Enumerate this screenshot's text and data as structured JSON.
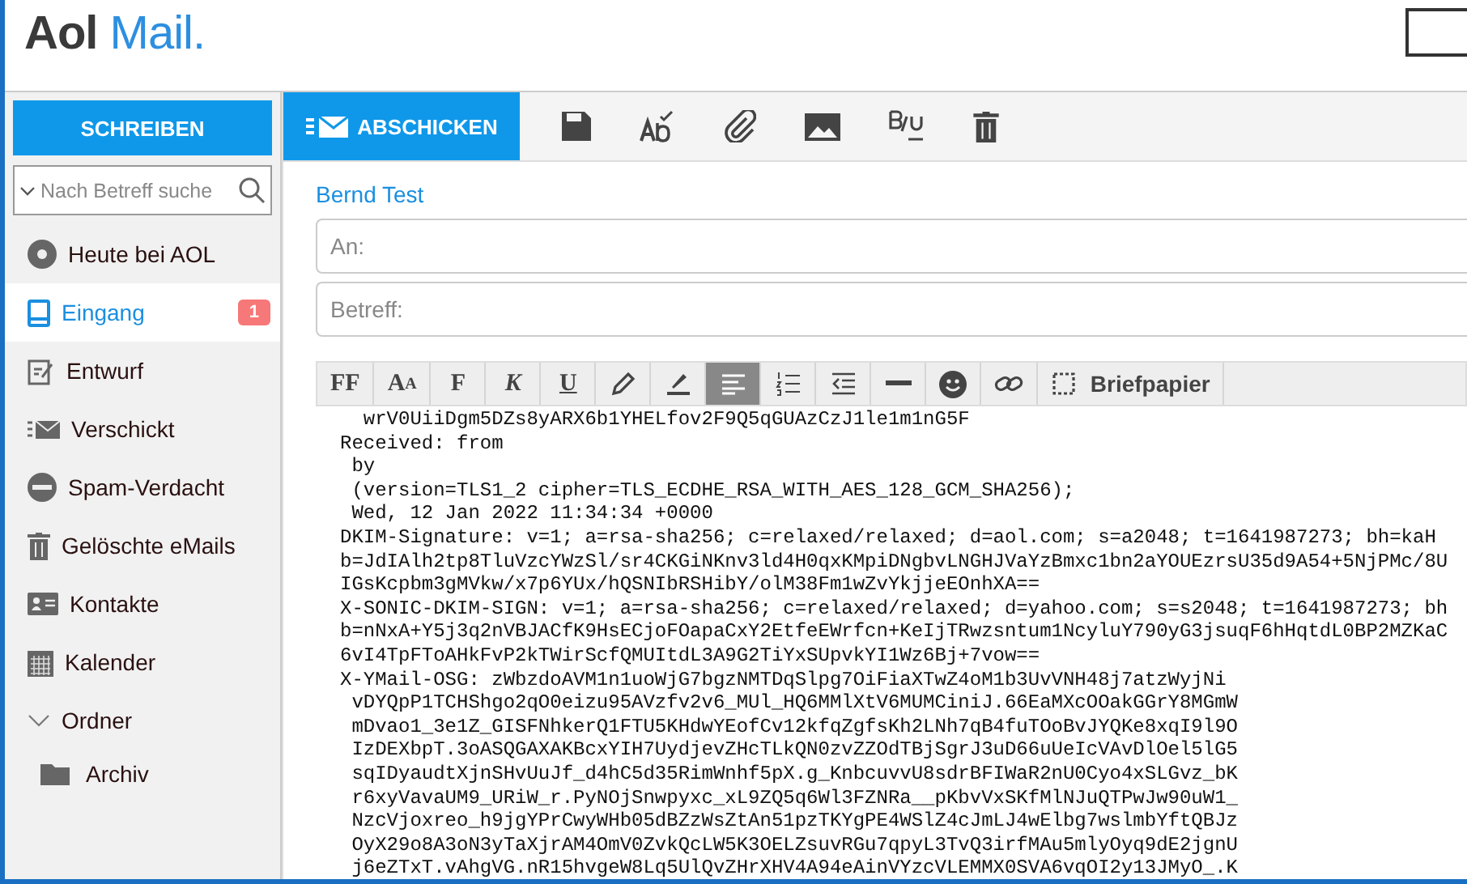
{
  "header": {
    "logo_bold": "Aol",
    "logo_light": "Mail."
  },
  "compose_button": "SCHREIBEN",
  "search": {
    "placeholder": "Nach Betreff suche"
  },
  "folders": [
    {
      "kind": "aol",
      "label": "Heute bei AOL",
      "selected": false
    },
    {
      "kind": "inbox",
      "label": "Eingang",
      "selected": true,
      "badge": "1"
    },
    {
      "kind": "draft",
      "label": "Entwurf",
      "selected": false
    },
    {
      "kind": "sent",
      "label": "Verschickt",
      "selected": false
    },
    {
      "kind": "spam",
      "label": "Spam-Verdacht",
      "selected": false
    },
    {
      "kind": "trash",
      "label": "Gelöschte eMails",
      "selected": false
    },
    {
      "kind": "contacts",
      "label": "Kontakte",
      "selected": false
    },
    {
      "kind": "calendar",
      "label": "Kalender",
      "selected": false
    },
    {
      "kind": "group",
      "label": "Ordner",
      "expanded": true,
      "children": [
        {
          "kind": "folder",
          "label": "Archiv",
          "selected": false
        }
      ]
    }
  ],
  "send_button": "ABSCHICKEN",
  "from": "Bernd Test",
  "to": {
    "placeholder": "An:"
  },
  "subject": {
    "placeholder": "Betreff:"
  },
  "format_tools": [
    {
      "kind": "font",
      "label": "FF",
      "selected": false
    },
    {
      "kind": "size",
      "label": "AA",
      "selected": false
    },
    {
      "kind": "bold",
      "label": "F",
      "selected": false
    },
    {
      "kind": "italic",
      "label": "K",
      "selected": false
    },
    {
      "kind": "underline",
      "label": "U",
      "selected": false
    },
    {
      "kind": "pen",
      "selected": false
    },
    {
      "kind": "highlight",
      "selected": false
    },
    {
      "kind": "align",
      "selected": true
    },
    {
      "kind": "list",
      "selected": false
    },
    {
      "kind": "outdent",
      "selected": false
    },
    {
      "kind": "rule",
      "selected": false
    },
    {
      "kind": "emoji",
      "selected": false
    },
    {
      "kind": "link",
      "selected": false
    },
    {
      "kind": "stationery",
      "label": "Briefpapier",
      "selected": false
    }
  ],
  "body_lines": [
    "  wrV0UiiDgm5DZs8yARX6b1YHELfov2F9Q5qGUAzCzJ1le1m1nG5F",
    "Received: from",
    " by",
    " (version=TLS1_2 cipher=TLS_ECDHE_RSA_WITH_AES_128_GCM_SHA256);",
    " Wed, 12 Jan 2022 11:34:34 +0000",
    "DKIM-Signature: v=1; a=rsa-sha256; c=relaxed/relaxed; d=aol.com; s=a2048; t=1641987273; bh=kaH",
    "b=JdIAlh2tp8TluVzcYWzSl/sr4CKGiNKnv3ld4H0qxKMpiDNgbvLNGHJVaYzBmxc1bn2aYOUEzrsU35d9A54+5NjPMc/8U",
    "IGsKcpbm3gMVkw/x7p6YUx/hQSNIbRSHibY/olM38Fm1wZvYkjjeEOnhXA==",
    "X-SONIC-DKIM-SIGN: v=1; a=rsa-sha256; c=relaxed/relaxed; d=yahoo.com; s=s2048; t=1641987273; bh",
    "b=nNxA+Y5j3q2nVBJACfK9HsECjoFOapaCxY2EtfeEWrfcn+KeIjTRwzsntum1NcyluY790yG3jsuqF6hHqtdL0BP2MZKaC",
    "6vI4TpFToAHkFvP2kTWirScfQMUItdL3A9G2TiYxSUpvkYI1Wz6Bj+7vow==",
    "X-YMail-OSG: zWbzdoAVM1n1uoWjG7bgzNMTDqSlpg7OiFiaXTwZ4oM1b3UvVNH48j7atzWyjNi",
    " vDYQpP1TCHShgo2qO0eizu95AVzfv2v6_MUl_HQ6MMlXtV6MUMCiniJ.66EaMXcOOakGGrY8MGmW",
    " mDvao1_3e1Z_GISFNhkerQ1FTU5KHdwYEofCv12kfqZgfsKh2LNh7qB4fuTOoBvJYQKe8xqI9l9O",
    " IzDEXbpT.3oASQGAXAKBcxYIH7UydjevZHcTLkQN0zvZZOdTBjSgrJ3uD66uUeIcVAvDlOel5lG5",
    " sqIDyaudtXjnSHvUuJf_d4hC5d35RimWnhf5pX.g_KnbcuvvU8sdrBFIWaR2nU0Cyo4xSLGvz_bK",
    " r6xyVavaUM9_URiW_r.PyNOjSnwpyxc_xL9ZQ5q6Wl3FZNRa__pKbvVxSKfMlNJuQTPwJw90uW1_",
    " NzcVjoxreo_h9jgYPrCwyWHb05dBZzWsZtAn51pzTKYgPE4WSlZ4cJmLJ4wElbg7wslmbYftQBJz",
    " OyX29o8A3oN3yTaXjrAM4OmV0ZvkQcLW5K3OELZsuvRGu7qpyL3TvQ3irfMAu5mlyOyq9dE2jgnU",
    " j6eZTxT.vAhgVG.nR15hvgeW8Lq5UlQvZHrXHV4A94eAinVYzcVLEMMX0SVA6vqOI2y13JMyO_.K"
  ]
}
